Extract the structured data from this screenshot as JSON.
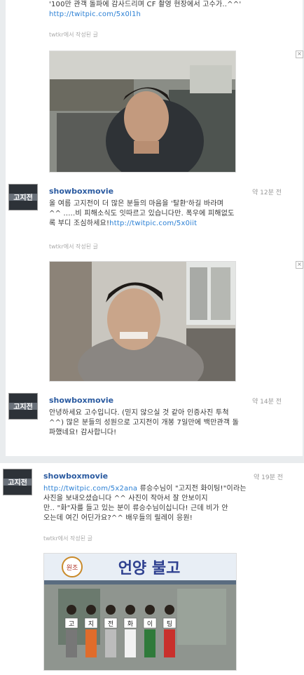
{
  "tweets": [
    {
      "text_lines": [
        "'100만 관객 돌파에 감사드리며 CF 촬영 현장에서 고수가..^^'"
      ],
      "link": "http://twitpic.com/5x0l1h",
      "via": "twtkr에서 작성된 글"
    },
    {
      "user": "showboxmovie",
      "time": "약 12분 전",
      "text_lines": [
        "올 여름 고지전이 더 많은 분들의 마음을 '탈환'하길 바라며",
        "^^ .....비 피해소식도 잇따르고 있습니다만. 폭우에 피해없도",
        "록 부디 조심하세요!"
      ],
      "link": "http://twitpic.com/5x0iit",
      "via": "twtkr에서 작성된 글"
    },
    {
      "user": "showboxmovie",
      "time": "약 14분 전",
      "text_lines": [
        "안녕하세요 고수입니다. (믿지 않으실 것 같아 인증사진 투척",
        "^^) 많은 분들의 성원으로 고지전이 개봉 7일만에 백만관객 돌",
        "파했네요! 감사합니다!"
      ]
    },
    {
      "user": "showboxmovie",
      "time": "약 19분 전",
      "link": "http://twitpic.com/5x2ana",
      "text_lines": [
        "류승수님이 \"고지전 화이팅!\"이라는",
        "사진을 보내오셨습니다 ^^ 사진이 작아서 잘 안보이지",
        "만.. \"화\"자를 들고 있는 분이 류승수님이십니다! 근데 비가 안",
        "오는데 여긴 어딘가요?^^ 배우들의 릴레이 응원!"
      ],
      "via": "twtkr에서 작성된 글"
    }
  ],
  "avatar": {
    "title": "고지전"
  },
  "close_symbol": "×",
  "restaurant_sign": "언양 불고",
  "sign_circle_text": "원조",
  "held_letters": [
    "고",
    "지",
    "전",
    "화",
    "이",
    "팅"
  ],
  "colors": {
    "username": "#2a5aa0",
    "link": "#2a7fd4",
    "meta": "#999999"
  }
}
